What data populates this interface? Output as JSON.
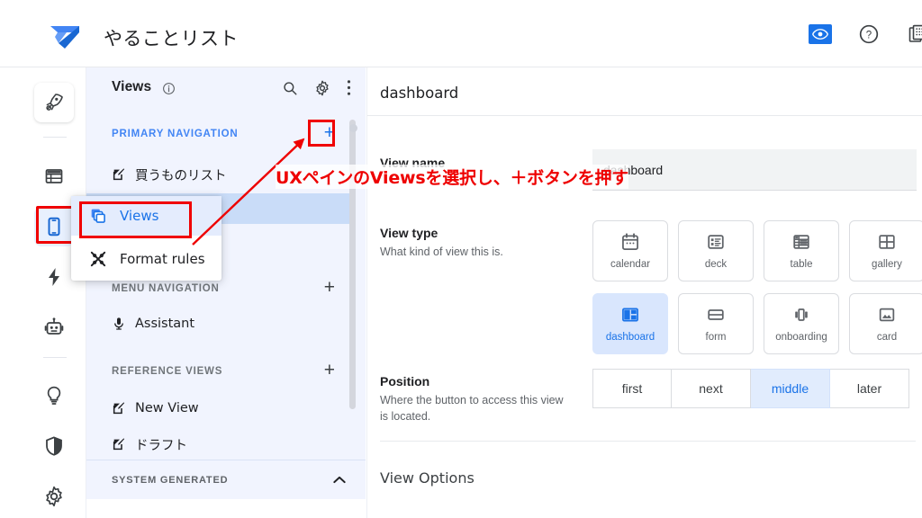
{
  "header": {
    "app_title": "やることリスト",
    "logo_name": "appsheet-logo",
    "actions": [
      {
        "name": "preview-eye-icon",
        "label": "Preview"
      },
      {
        "name": "help-icon",
        "label": "Help"
      },
      {
        "name": "copy-app-icon",
        "label": "Copy app"
      }
    ]
  },
  "rail": {
    "items": [
      {
        "name": "rocket-icon",
        "label": "Launch"
      },
      {
        "name": "data-icon",
        "label": "Data"
      },
      {
        "name": "mobile-device-icon",
        "label": "UX"
      },
      {
        "name": "bolt-icon",
        "label": "Automation"
      },
      {
        "name": "robot-icon",
        "label": "Intelligence"
      },
      {
        "name": "lightbulb-icon",
        "label": "Insights"
      },
      {
        "name": "shield-icon",
        "label": "Security"
      },
      {
        "name": "gear-icon",
        "label": "Settings"
      }
    ],
    "selected_index": 2
  },
  "panel": {
    "title": "Views",
    "info_icon": "info-icon",
    "head_icons": [
      {
        "name": "search-icon",
        "label": "Search"
      },
      {
        "name": "gear-icon",
        "label": "Settings"
      },
      {
        "name": "more-vert-icon",
        "label": "More options"
      }
    ],
    "sections": [
      {
        "heading": "PRIMARY NAVIGATION",
        "add_label": "+",
        "items": [
          {
            "label": "買うものリスト",
            "icon": "edit-square-icon",
            "selected": false
          },
          {
            "label": "",
            "icon": "",
            "selected": true
          }
        ]
      },
      {
        "heading": "MENU NAVIGATION",
        "add_label": "+",
        "items": [
          {
            "label": "Assistant",
            "icon": "microphone-icon",
            "selected": false
          }
        ]
      },
      {
        "heading": "REFERENCE VIEWS",
        "add_label": "+",
        "items": [
          {
            "label": "New View",
            "icon": "edit-square-icon",
            "selected": false
          },
          {
            "label": "ドラフト",
            "icon": "edit-square-icon",
            "selected": false
          }
        ]
      }
    ],
    "system_generated": {
      "label": "SYSTEM GENERATED",
      "chevron": "chevron-up-icon"
    }
  },
  "popup": {
    "items": [
      {
        "label": "Views",
        "icon": "copy-layers-icon",
        "active": true
      },
      {
        "label": "Format rules",
        "icon": "format-rules-icon",
        "active": false
      }
    ]
  },
  "main": {
    "title": "dashboard",
    "fields": {
      "view_name": {
        "label": "View name",
        "value": "dashboard",
        "placeholder": "View name"
      },
      "view_type": {
        "label": "View type",
        "sub": "What kind of view this is.",
        "options": [
          {
            "label": "calendar",
            "icon": "calendar-icon",
            "selected": false
          },
          {
            "label": "deck",
            "icon": "deck-icon",
            "selected": false
          },
          {
            "label": "table",
            "icon": "table-icon",
            "selected": false
          },
          {
            "label": "gallery",
            "icon": "gallery-icon",
            "selected": false
          },
          {
            "label": "dashboard",
            "icon": "dashboard-icon",
            "selected": true
          },
          {
            "label": "form",
            "icon": "form-icon",
            "selected": false
          },
          {
            "label": "onboarding",
            "icon": "onboarding-icon",
            "selected": false
          },
          {
            "label": "card",
            "icon": "card-icon",
            "selected": false
          }
        ]
      },
      "position": {
        "label": "Position",
        "sub": "Where the button to access this view is located.",
        "options": [
          {
            "label": "first",
            "selected": false
          },
          {
            "label": "next",
            "selected": false
          },
          {
            "label": "middle",
            "selected": true
          },
          {
            "label": "later",
            "selected": false
          }
        ]
      }
    },
    "view_options_heading": "View Options"
  },
  "annotation": {
    "text": "UXペインのViewsを選択し、＋ボタンを押す",
    "color": "#ee0000",
    "highlight_boxes": [
      "ux-rail-icon",
      "views-menu-item",
      "primary-navigation-plus"
    ]
  },
  "colors": {
    "accent_blue": "#1a73e8",
    "panel_bg": "#f1f4fe",
    "selected_row": "#c9dcf8",
    "selected_chip": "#d9e6fd",
    "annotation_red": "#ee0000"
  }
}
